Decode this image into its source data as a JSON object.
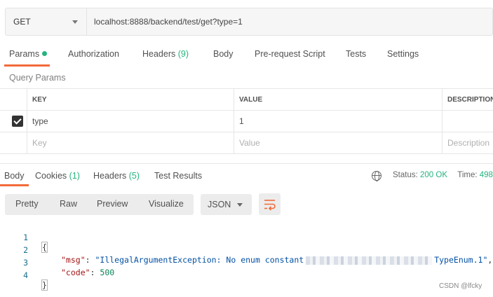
{
  "request": {
    "method": "GET",
    "url": "localhost:8888/backend/test/get?type=1"
  },
  "request_tabs": [
    {
      "label": "Params",
      "count": "",
      "active": true,
      "dot": true
    },
    {
      "label": "Authorization",
      "count": ""
    },
    {
      "label": "Headers",
      "count": "(9)"
    },
    {
      "label": "Body",
      "count": ""
    },
    {
      "label": "Pre-request Script",
      "count": ""
    },
    {
      "label": "Tests",
      "count": ""
    },
    {
      "label": "Settings",
      "count": ""
    }
  ],
  "query_params": {
    "title": "Query Params",
    "columns": [
      "KEY",
      "VALUE",
      "DESCRIPTION"
    ],
    "rows": [
      {
        "checked": true,
        "key": "type",
        "value": "1",
        "description": ""
      }
    ],
    "placeholders": {
      "key": "Key",
      "value": "Value",
      "description": "Description"
    }
  },
  "response_tabs": [
    {
      "label": "Body",
      "count": "",
      "active": true
    },
    {
      "label": "Cookies",
      "count": "(1)"
    },
    {
      "label": "Headers",
      "count": "(5)"
    },
    {
      "label": "Test Results",
      "count": ""
    }
  ],
  "status": {
    "status_label": "Status:",
    "status_value": "200 OK",
    "time_label": "Time:",
    "time_value": "498"
  },
  "format_buttons": [
    "Pretty",
    "Raw",
    "Preview",
    "Visualize"
  ],
  "format_select": "JSON",
  "code_lines": {
    "numbers": [
      "1",
      "2",
      "3",
      "4"
    ],
    "open_brace": "{",
    "msg_key": "\"msg\"",
    "msg_value_start": "\"IllegalArgumentException: No enum constant",
    "msg_value_end": "TypeEnum.1\"",
    "code_key": "\"code\"",
    "code_value": "500",
    "close_brace": "}"
  },
  "watermark": "CSDN @lfcky",
  "icons": {
    "method_dropdown": "chevron-down-icon",
    "checkbox": "checkbox-checked-icon",
    "globe": "globe-icon",
    "json_dropdown": "chevron-down-icon",
    "wrap": "wrap-lines-icon"
  },
  "colors": {
    "accent": "#f26b3a",
    "success": "#26b47f"
  }
}
